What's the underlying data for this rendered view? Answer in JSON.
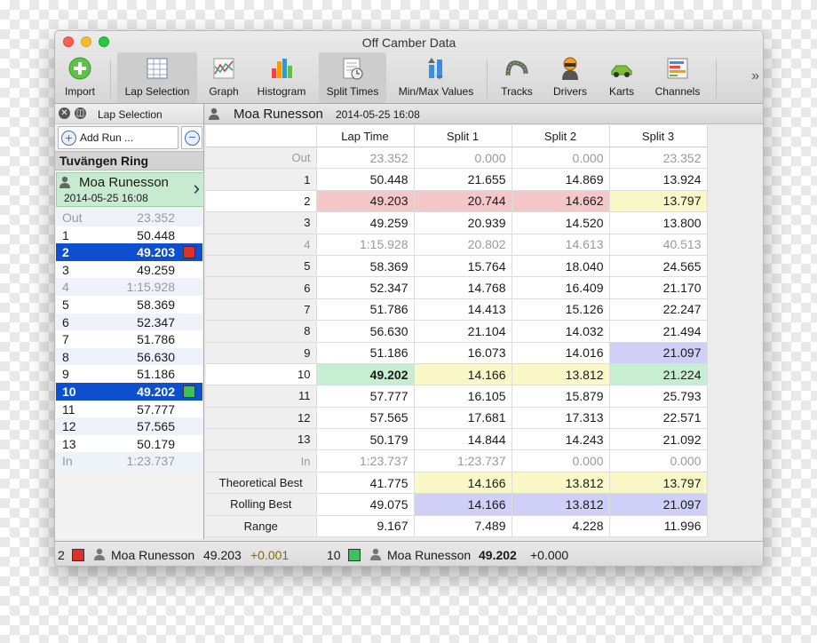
{
  "window": {
    "title": "Off Camber Data"
  },
  "toolbar": {
    "buttons": [
      {
        "label": "Import",
        "icon": "import-icon"
      },
      {
        "label": "Lap Selection",
        "icon": "lap-selection-icon",
        "selected": true
      },
      {
        "label": "Graph",
        "icon": "graph-icon"
      },
      {
        "label": "Histogram",
        "icon": "histogram-icon"
      },
      {
        "label": "Split Times",
        "icon": "split-times-icon",
        "selected": true
      },
      {
        "label": "Min/Max Values",
        "icon": "min-max-icon"
      },
      {
        "label": "Tracks",
        "icon": "tracks-icon"
      },
      {
        "label": "Drivers",
        "icon": "drivers-icon"
      },
      {
        "label": "Karts",
        "icon": "karts-icon"
      },
      {
        "label": "Channels",
        "icon": "channels-icon"
      }
    ],
    "overflow": "»"
  },
  "lap_panel": {
    "title": "Lap Selection",
    "add_run_label": "Add Run ...",
    "track_name": "Tuvängen Ring",
    "run": {
      "driver": "Moa Runesson",
      "date": "2014-05-25 16:08"
    },
    "laps": [
      {
        "lap": "Out",
        "time": "23.352",
        "dim": true
      },
      {
        "lap": "1",
        "time": "50.448"
      },
      {
        "lap": "2",
        "time": "49.203",
        "selected": true,
        "marker": "#e0302a"
      },
      {
        "lap": "3",
        "time": "49.259"
      },
      {
        "lap": "4",
        "time": "1:15.928",
        "dim": true
      },
      {
        "lap": "5",
        "time": "58.369"
      },
      {
        "lap": "6",
        "time": "52.347"
      },
      {
        "lap": "7",
        "time": "51.786"
      },
      {
        "lap": "8",
        "time": "56.630"
      },
      {
        "lap": "9",
        "time": "51.186"
      },
      {
        "lap": "10",
        "time": "49.202",
        "selected": true,
        "marker": "#3ec05a"
      },
      {
        "lap": "11",
        "time": "57.777"
      },
      {
        "lap": "12",
        "time": "57.565"
      },
      {
        "lap": "13",
        "time": "50.179"
      },
      {
        "lap": "In",
        "time": "1:23.737",
        "dim": true
      }
    ]
  },
  "split_table": {
    "driver": "Moa Runesson",
    "date": "2014-05-25 16:08",
    "columns": [
      "",
      "Lap Time",
      "Split 1",
      "Split 2",
      "Split 3"
    ],
    "rows": [
      {
        "label": "Out",
        "values": [
          "23.352",
          "0.000",
          "0.000",
          "23.352"
        ],
        "dim": true
      },
      {
        "label": "1",
        "values": [
          "50.448",
          "21.655",
          "14.869",
          "13.924"
        ]
      },
      {
        "label": "2",
        "values": [
          "49.203",
          "20.744",
          "14.662",
          "13.797"
        ],
        "row_class": "rowred",
        "cell_classes": [
          "",
          "",
          "",
          "yel"
        ]
      },
      {
        "label": "3",
        "values": [
          "49.259",
          "20.939",
          "14.520",
          "13.800"
        ]
      },
      {
        "label": "4",
        "values": [
          "1:15.928",
          "20.802",
          "14.613",
          "40.513"
        ],
        "dim": true
      },
      {
        "label": "5",
        "values": [
          "58.369",
          "15.764",
          "18.040",
          "24.565"
        ]
      },
      {
        "label": "6",
        "values": [
          "52.347",
          "14.768",
          "16.409",
          "21.170"
        ]
      },
      {
        "label": "7",
        "values": [
          "51.786",
          "14.413",
          "15.126",
          "22.247"
        ]
      },
      {
        "label": "8",
        "values": [
          "56.630",
          "21.104",
          "14.032",
          "21.494"
        ]
      },
      {
        "label": "9",
        "values": [
          "51.186",
          "16.073",
          "14.016",
          "21.097"
        ],
        "cell_classes": [
          "",
          "",
          "",
          "blu"
        ]
      },
      {
        "label": "10",
        "values": [
          "49.202",
          "14.166",
          "13.812",
          "21.224"
        ],
        "row_class": "rowgreen",
        "cell_classes": [
          "bold",
          "yel",
          "yel",
          ""
        ]
      },
      {
        "label": "11",
        "values": [
          "57.777",
          "16.105",
          "15.879",
          "25.793"
        ]
      },
      {
        "label": "12",
        "values": [
          "57.565",
          "17.681",
          "17.313",
          "22.571"
        ]
      },
      {
        "label": "13",
        "values": [
          "50.179",
          "14.844",
          "14.243",
          "21.092"
        ]
      },
      {
        "label": "In",
        "values": [
          "1:23.737",
          "1:23.737",
          "0.000",
          "0.000"
        ],
        "dim": true
      },
      {
        "label": "Theoretical Best",
        "values": [
          "41.775",
          "14.166",
          "13.812",
          "13.797"
        ],
        "cell_classes": [
          "",
          "yel",
          "yel",
          "yel"
        ],
        "tall": true
      },
      {
        "label": "Rolling Best",
        "values": [
          "49.075",
          "14.166",
          "13.812",
          "21.097"
        ],
        "cell_classes": [
          "",
          "blu",
          "blu",
          "blu"
        ],
        "tall": true
      },
      {
        "label": "Range",
        "values": [
          "9.167",
          "7.489",
          "4.228",
          "11.996"
        ],
        "tall": true
      }
    ]
  },
  "status_bar": {
    "left": {
      "lap": "2",
      "color": "#e0302a",
      "driver": "Moa Runesson",
      "time": "49.203",
      "delta": "+0.001"
    },
    "right": {
      "lap": "10",
      "color": "#3ec05a",
      "driver": "Moa Runesson",
      "time": "49.202",
      "delta": "+0.000"
    }
  },
  "colors": {
    "selection": "#0e4fcf",
    "accent_red": "#f6c7c8",
    "accent_green": "#c6efd1",
    "yellow": "#fbf8c7",
    "blue": "#cfcff7"
  }
}
